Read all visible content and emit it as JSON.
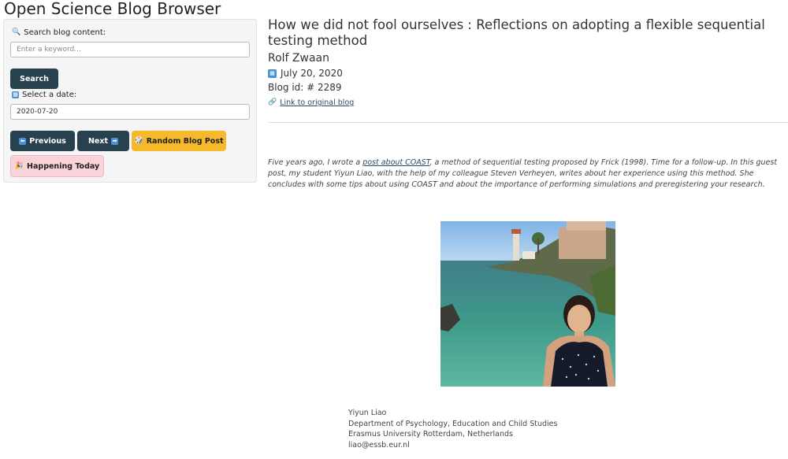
{
  "app": {
    "title": "Open Science Blog Browser"
  },
  "sidebar": {
    "search_label": "Search blog content:",
    "search_icon": "magnifier-icon",
    "search_placeholder": "Enter a keyword...",
    "search_value": "",
    "search_button": "Search",
    "date_label": "Select a date:",
    "date_icon": "calendar-icon",
    "date_value": "2020-07-20",
    "prev_button": "Previous",
    "next_button": "Next",
    "random_button": "Random Blog Post",
    "today_button": "Happening Today",
    "colors": {
      "dark_button": "#28414e",
      "random_button": "#f6b92b",
      "today_button": "#f8d3d8"
    }
  },
  "post": {
    "title": "How we did not fool ourselves : Reflections on adopting a flexible sequential testing method",
    "author": "Rolf Zwaan",
    "date": "July 20, 2020",
    "blog_id_label": "Blog id: # 2289",
    "link_label": "Link to original blog",
    "intro_pre": "Five years ago, I wrote a ",
    "intro_link": "post about COAST",
    "intro_post": ", a method of sequential testing proposed by Frick (1998). Time for a follow-up. In this guest post, my student Yiyun Liao, with the help of my colleague Steven Verheyen, writes about her experience using this method. She concludes with some tips about using COAST and about the importance of performing simulations and preregistering your research.",
    "signature": {
      "name": "Yiyun Liao",
      "department": "Department of Psychology, Education and Child Studies",
      "university": "Erasmus University Rotterdam, Netherlands",
      "email": "liao@essb.eur.nl"
    }
  }
}
